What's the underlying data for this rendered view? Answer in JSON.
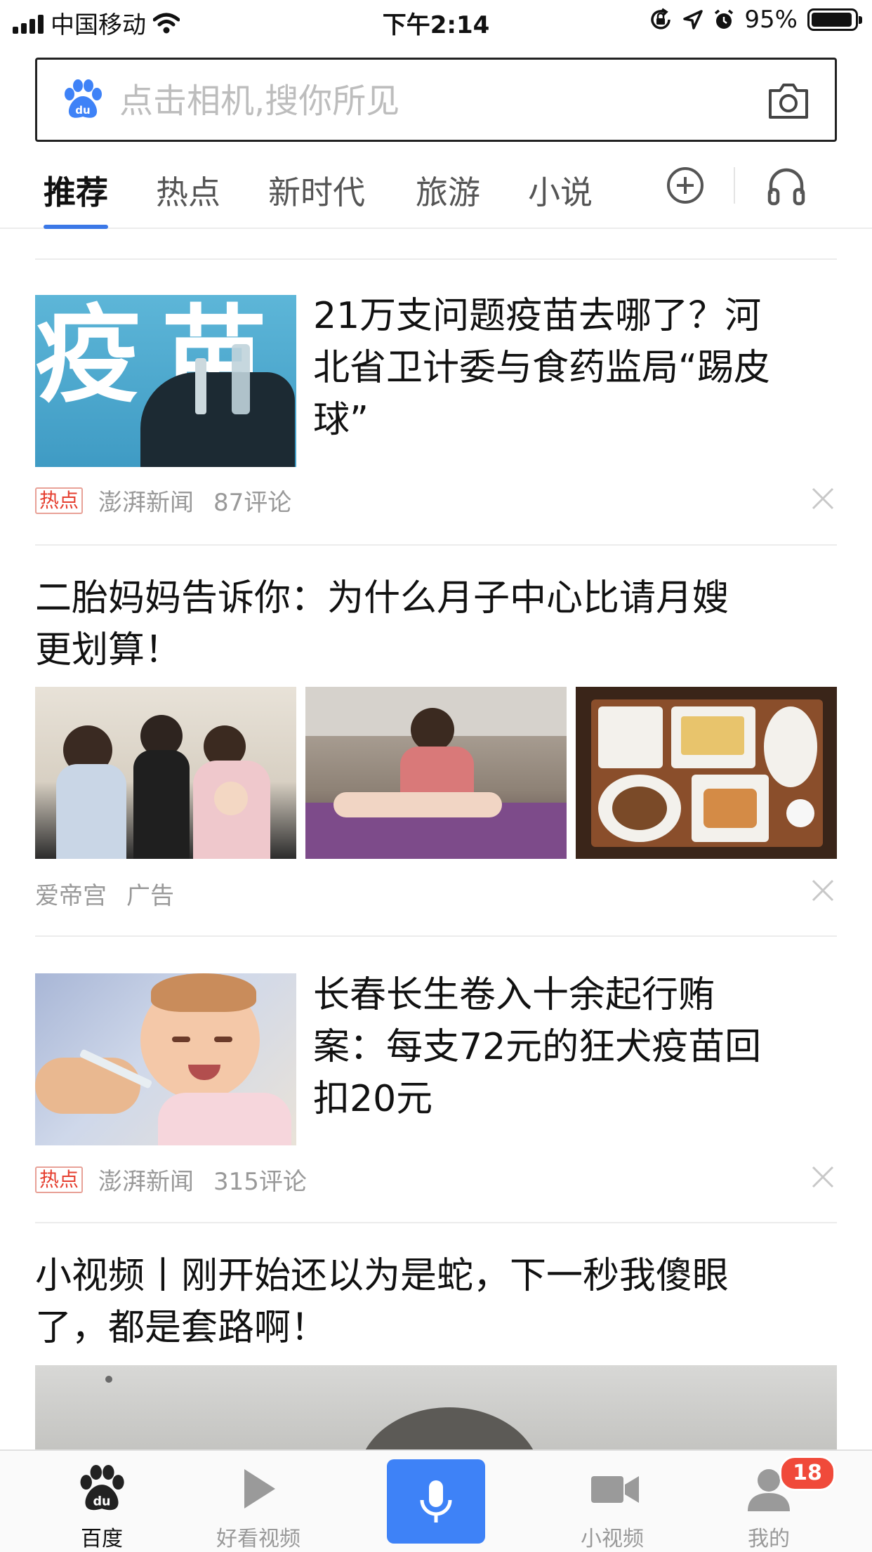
{
  "status_bar": {
    "carrier": "中国移动",
    "time": "下午2:14",
    "battery": "95%",
    "battery_level": 0.95,
    "icons": [
      "signal-icon",
      "wifi-icon",
      "rotation-lock-icon",
      "location-icon",
      "alarm-icon",
      "battery-icon"
    ]
  },
  "search": {
    "placeholder": "点击相机,搜你所见",
    "value": "",
    "icons": [
      "baidu-paw-icon",
      "camera-icon"
    ]
  },
  "tabs": {
    "items": [
      {
        "label": "推荐",
        "active": true
      },
      {
        "label": "热点",
        "active": false
      },
      {
        "label": "新时代",
        "active": false
      },
      {
        "label": "旅游",
        "active": false
      },
      {
        "label": "小说",
        "active": false
      }
    ],
    "accent": "#3b78e7",
    "icons": [
      "add-circle-icon",
      "headphones-icon"
    ]
  },
  "feed": {
    "articles": [
      {
        "title_lines": [
          "21万支问题疫苗去哪了？河",
          "北省卫计委与食药监局“踢皮",
          "球”"
        ],
        "image_text": "疫苗",
        "tag": "热点",
        "source": "澎湃新闻",
        "comments": "87评论"
      },
      {
        "title_lines": [
          "二胎妈妈告诉你：为什么月子中心比请月嫂",
          "更划算！"
        ],
        "source": "爱帝宫",
        "ad_label": "广告"
      },
      {
        "title_lines": [
          "长春长生卷入十余起行贿",
          "案：每支72元的狂犬疫苗回",
          "扣20元"
        ],
        "tag": "热点",
        "source": "澎湃新闻",
        "comments": "315评论"
      },
      {
        "title_lines": [
          "小视频丨刚开始还以为是蛇，下一秒我傻眼",
          "了，都是套路啊！"
        ]
      }
    ],
    "tag_color": "#e53e2f"
  },
  "bottom_nav": {
    "items": [
      {
        "label": "百度",
        "icon": "baidu-paw-icon",
        "active": true
      },
      {
        "label": "好看视频",
        "icon": "play-icon",
        "active": false
      },
      {
        "label": "",
        "icon": "microphone-icon",
        "active": false
      },
      {
        "label": "小视频",
        "icon": "video-camera-icon",
        "active": false
      },
      {
        "label": "我的",
        "icon": "user-icon",
        "active": false
      }
    ],
    "badge": "18",
    "mic_color": "#3e82f7"
  }
}
